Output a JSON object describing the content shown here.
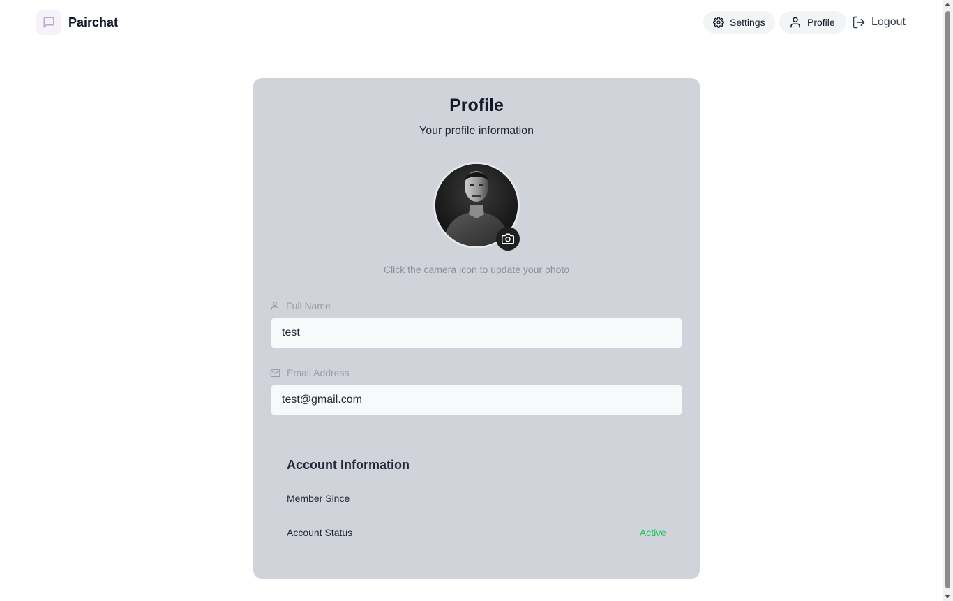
{
  "header": {
    "brand": "Pairchat",
    "nav": {
      "settings": "Settings",
      "profile": "Profile",
      "logout": "Logout"
    }
  },
  "profile": {
    "title": "Profile",
    "subtitle": "Your profile information",
    "photo_hint": "Click the camera icon to update your photo",
    "full_name": {
      "label": "Full Name",
      "value": "test"
    },
    "email": {
      "label": "Email Address",
      "value": "test@gmail.com"
    }
  },
  "account": {
    "title": "Account Information",
    "member_since_label": "Member Since",
    "member_since_value": "",
    "status_label": "Account Status",
    "status_value": "Active"
  },
  "colors": {
    "card_bg": "#d1d3da",
    "status_active": "#22c55e",
    "logo_bg": "#f5f2fa",
    "logo_icon": "#b9a7d6"
  },
  "icons": {
    "brand": "message-square-icon",
    "settings": "gear-icon",
    "profile": "user-icon",
    "logout": "logout-icon",
    "camera": "camera-icon",
    "name_field": "user-icon",
    "email_field": "mail-icon"
  }
}
